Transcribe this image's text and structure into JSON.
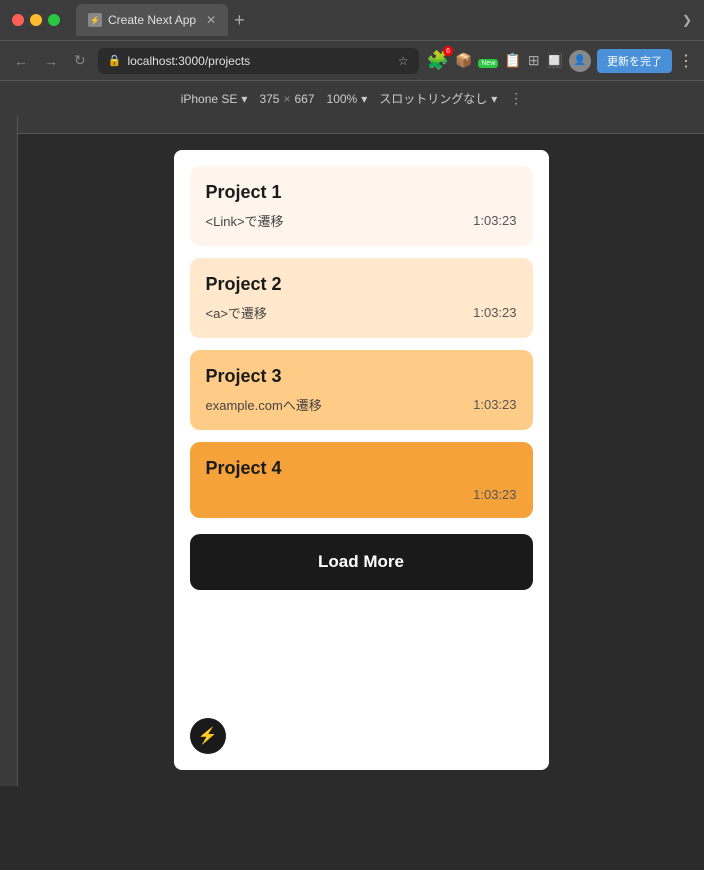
{
  "titleBar": {
    "tabTitle": "Create Next App",
    "tabNew": "+",
    "tabChevron": "❯",
    "favicon": "⚡"
  },
  "addressBar": {
    "url": "localhost:3000/projects",
    "updateLabel": "更新を完了",
    "moreLabel": "⋮"
  },
  "deviceBar": {
    "deviceName": "iPhone SE",
    "width": "375",
    "cross": "×",
    "height": "667",
    "zoom": "100%",
    "throttle": "スロットリングなし",
    "chevronDown": "▾",
    "moreIcon": "⋮",
    "shieldIcon": "🛡"
  },
  "projects": [
    {
      "id": 1,
      "title": "Project 1",
      "subtitle": "<Link>で遷移",
      "time": "1:03:23",
      "colorClass": "p1"
    },
    {
      "id": 2,
      "title": "Project 2",
      "subtitle": "<a>で遷移",
      "time": "1:03:23",
      "colorClass": "p2"
    },
    {
      "id": 3,
      "title": "Project 3",
      "subtitle": "example.comへ遷移",
      "time": "1:03:23",
      "colorClass": "p3"
    },
    {
      "id": 4,
      "title": "Project 4",
      "subtitle": "",
      "time": "1:03:23",
      "colorClass": "p4"
    }
  ],
  "loadMore": "Load More",
  "lightningIcon": "⚡"
}
